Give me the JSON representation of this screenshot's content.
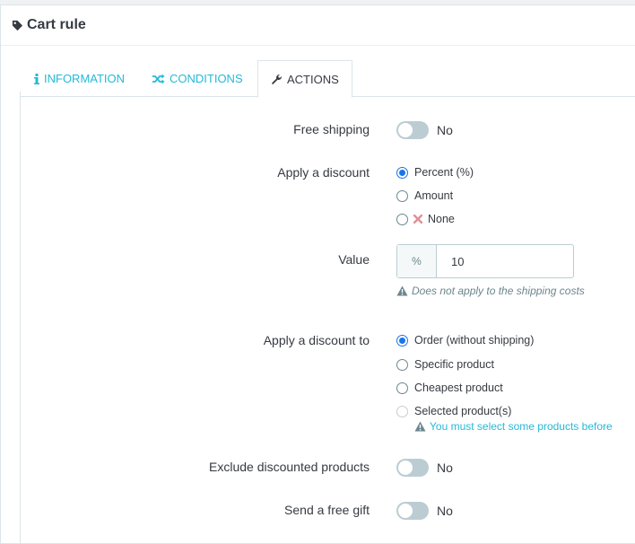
{
  "panel": {
    "title": "Cart rule",
    "title_icon": "tag-icon"
  },
  "tabs": [
    {
      "label": "INFORMATION",
      "icon": "info-icon",
      "active": false
    },
    {
      "label": "CONDITIONS",
      "icon": "shuffle-icon",
      "active": false
    },
    {
      "label": "ACTIONS",
      "icon": "wrench-icon",
      "active": true
    }
  ],
  "form": {
    "free_shipping": {
      "label": "Free shipping",
      "value": "No",
      "enabled": false
    },
    "apply_discount": {
      "label": "Apply a discount",
      "options": [
        {
          "label": "Percent (%)",
          "checked": true
        },
        {
          "label": "Amount",
          "checked": false
        },
        {
          "label": "None",
          "checked": false,
          "icon": "x-icon"
        }
      ]
    },
    "value": {
      "label": "Value",
      "addon": "%",
      "input": "10",
      "help": "Does not apply to the shipping costs"
    },
    "apply_discount_to": {
      "label": "Apply a discount to",
      "options": [
        {
          "label": "Order (without shipping)",
          "checked": true
        },
        {
          "label": "Specific product",
          "checked": false
        },
        {
          "label": "Cheapest product",
          "checked": false
        },
        {
          "label": "Selected product(s)",
          "checked": false,
          "disabled": true
        }
      ],
      "warning": "You must select some products before"
    },
    "exclude_discounted": {
      "label": "Exclude discounted products",
      "value": "No",
      "enabled": false
    },
    "free_gift": {
      "label": "Send a free gift",
      "value": "No",
      "enabled": false
    }
  },
  "colors": {
    "accent": "#25b9d7",
    "radio_checked": "#1a73e8",
    "switch_off": "#bbcdd2",
    "danger": "#e08f95"
  }
}
